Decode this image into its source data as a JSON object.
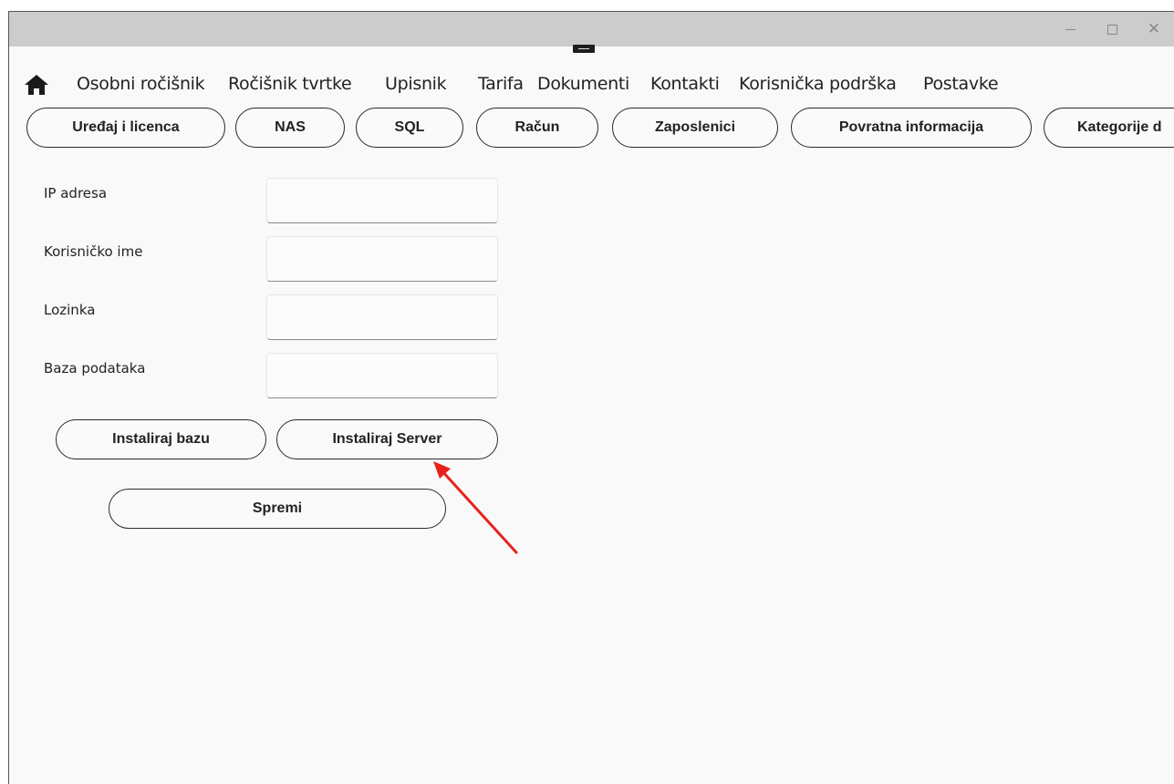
{
  "window": {
    "controls": {
      "minimize": "—",
      "maximize": "☐",
      "close": "✕"
    }
  },
  "menu": {
    "home_icon": "home-icon",
    "items": [
      "Osobni ročišnik",
      "Ročišnik tvrtke",
      "Upisnik",
      "Tarifa",
      "Dokumenti",
      "Kontakti",
      "Korisnička podrška",
      "Postavke"
    ]
  },
  "tabs": [
    "Uređaj i licenca",
    "NAS",
    "SQL",
    "Račun",
    "Zaposlenici",
    "Povratna informacija",
    "Kategorije d"
  ],
  "form": {
    "fields": [
      {
        "label": "IP adresa",
        "value": ""
      },
      {
        "label": "Korisničko ime",
        "value": ""
      },
      {
        "label": "Lozinka",
        "value": ""
      },
      {
        "label": "Baza podataka",
        "value": ""
      }
    ],
    "install_db_label": "Instaliraj bazu",
    "install_server_label": "Instaliraj Server",
    "save_label": "Spremi"
  },
  "annotation": {
    "arrow_color": "#e8221b"
  }
}
